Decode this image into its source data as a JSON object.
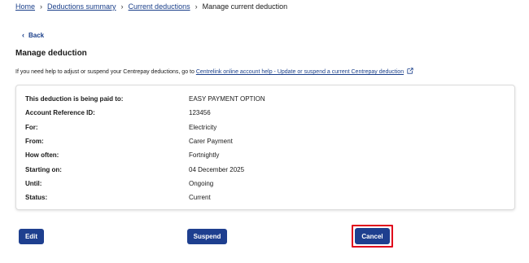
{
  "breadcrumb": {
    "items": [
      "Home",
      "Deductions summary",
      "Current deductions"
    ],
    "current": "Manage current deduction",
    "separator": "›"
  },
  "back": {
    "label": "Back"
  },
  "page_title": "Manage deduction",
  "help": {
    "text": "If you need help to adjust or suspend your Centrepay deductions, go to",
    "link": "Centrelink online account help - Update or suspend a current Centrepay deduction"
  },
  "details": [
    {
      "label": "This deduction is being paid to:",
      "value": "EASY PAYMENT OPTION"
    },
    {
      "label": "Account Reference ID:",
      "value": "123456"
    },
    {
      "label": "For:",
      "value": "Electricity"
    },
    {
      "label": "From:",
      "value": "Carer Payment"
    },
    {
      "label": "How often:",
      "value": "Fortnightly"
    },
    {
      "label": "Starting on:",
      "value": "04 December 2025"
    },
    {
      "label": "Until:",
      "value": "Ongoing"
    },
    {
      "label": "Status:",
      "value": "Current"
    }
  ],
  "buttons": {
    "edit": "Edit",
    "suspend": "Suspend",
    "cancel": "Cancel"
  },
  "colors": {
    "primary": "#1e3f8f",
    "link": "#1a3f8a",
    "highlight": "#e0001b"
  },
  "icons": {
    "back": "chevron-left-icon",
    "external": "external-link-icon"
  }
}
